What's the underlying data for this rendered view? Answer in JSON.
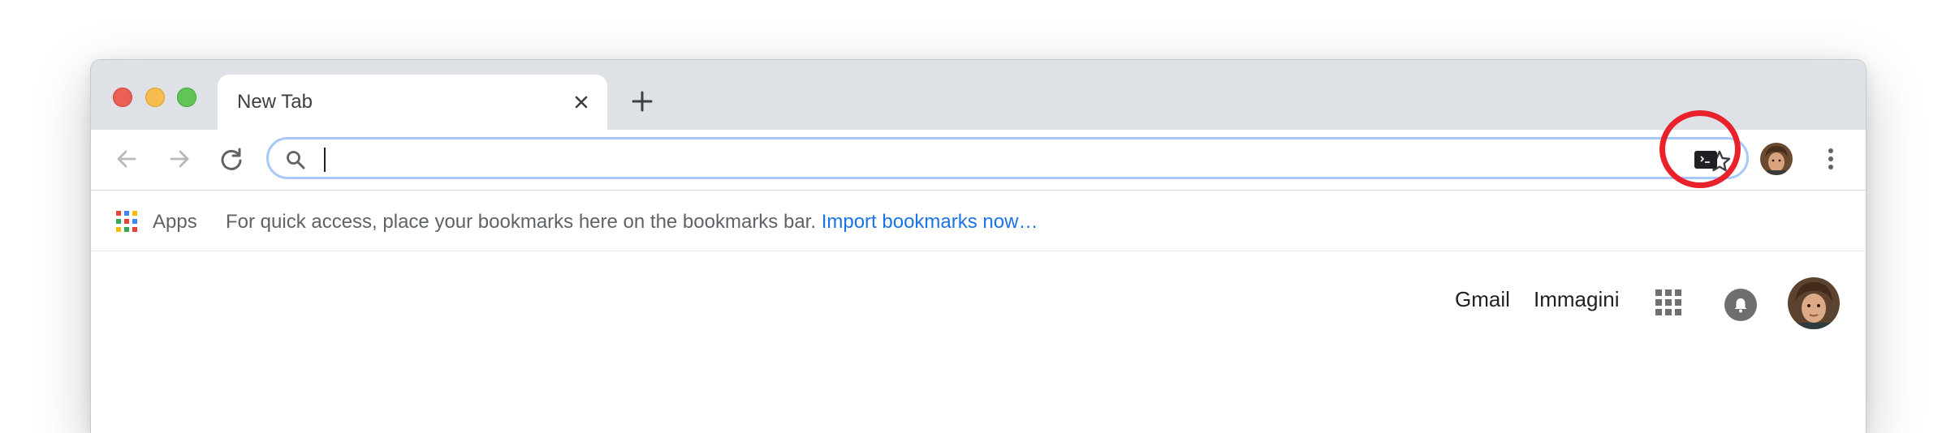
{
  "tab": {
    "title": "New Tab"
  },
  "omnibox": {
    "value": "",
    "placeholder": ""
  },
  "bookmarks_bar": {
    "apps_label": "Apps",
    "hint": "For quick access, place your bookmarks here on the bookmarks bar.",
    "import_link": "Import bookmarks now…"
  },
  "google_bar": {
    "gmail": "Gmail",
    "images": "Immagini"
  },
  "colors": {
    "tabstrip": "#dee1e6",
    "link": "#1a73e8",
    "omnibox_focus": "#a8c7fa",
    "highlight_ring": "#e8212a"
  },
  "icons": {
    "toolbar": [
      "back-arrow-icon",
      "forward-arrow-icon",
      "reload-icon",
      "search-icon",
      "star-icon",
      "terminal-extension-icon",
      "profile-avatar",
      "kebab-menu-icon"
    ],
    "page": [
      "apps-grid-icon",
      "notifications-bell-icon",
      "account-avatar"
    ]
  }
}
